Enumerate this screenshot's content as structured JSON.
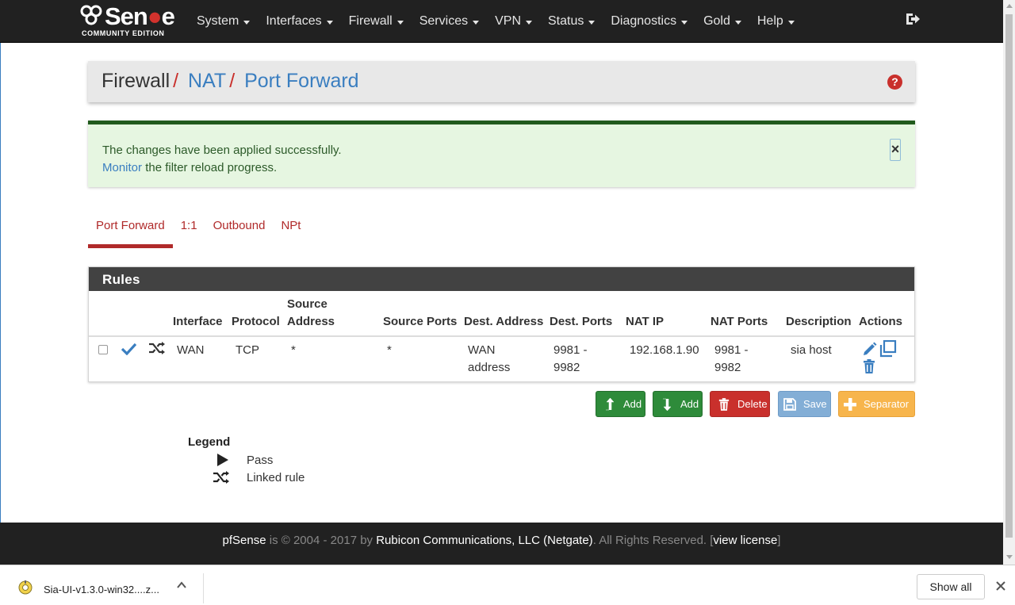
{
  "navbar": {
    "logo_main_a": "Sen",
    "logo_main_b": "e",
    "logo_sub": "COMMUNITY EDITION",
    "menu": [
      "System",
      "Interfaces",
      "Firewall",
      "Services",
      "VPN",
      "Status",
      "Diagnostics",
      "Gold",
      "Help"
    ]
  },
  "breadcrumb": {
    "root": "Firewall",
    "sep": "/",
    "level1": "NAT",
    "level2": "Port Forward",
    "help_icon": "?"
  },
  "alert": {
    "line1": "The changes have been applied successfully.",
    "link": "Monitor",
    "line2_rest": " the filter reload progress.",
    "close": "×"
  },
  "tabs": [
    "Port Forward",
    "1:1",
    "Outbound",
    "NPt"
  ],
  "rules": {
    "title": "Rules",
    "headers": {
      "interface": "Interface",
      "protocol": "Protocol",
      "source_address_1": "Source",
      "source_address_2": "Address",
      "source_ports": "Source Ports",
      "dest_address": "Dest. Address",
      "dest_ports": "Dest. Ports",
      "nat_ip": "NAT IP",
      "nat_ports": "NAT Ports",
      "description": "Description",
      "actions": "Actions"
    },
    "row": {
      "interface": "WAN",
      "protocol": "TCP",
      "source_address": "*",
      "source_ports": "*",
      "dest_address_1": "WAN",
      "dest_address_2": "address",
      "dest_ports_1": "9981 -",
      "dest_ports_2": "9982",
      "nat_ip": "192.168.1.90",
      "nat_ports_1": "9981 -",
      "nat_ports_2": "9982",
      "description": "sia host"
    }
  },
  "buttons": {
    "add_top": "Add",
    "add_bottom": "Add",
    "delete": "Delete",
    "save": "Save",
    "separator": "Separator"
  },
  "legend": {
    "title": "Legend",
    "pass": "Pass",
    "linked": "Linked rule"
  },
  "footer": {
    "brand": "pfSense",
    "mid": " is © 2004 - 2017 by ",
    "company": "Rubicon Communications, LLC (Netgate)",
    "rights": ". All Rights Reserved. [",
    "license": "view license",
    "end": "]"
  },
  "download_bar": {
    "filename": "Sia-UI-v1.3.0-win32....z...",
    "show_all": "Show all"
  },
  "colors": {
    "navbar": "#212121",
    "accent_red": "#c9302c",
    "link_blue": "#3a7ec0",
    "success_green": "#2e8b3a"
  }
}
